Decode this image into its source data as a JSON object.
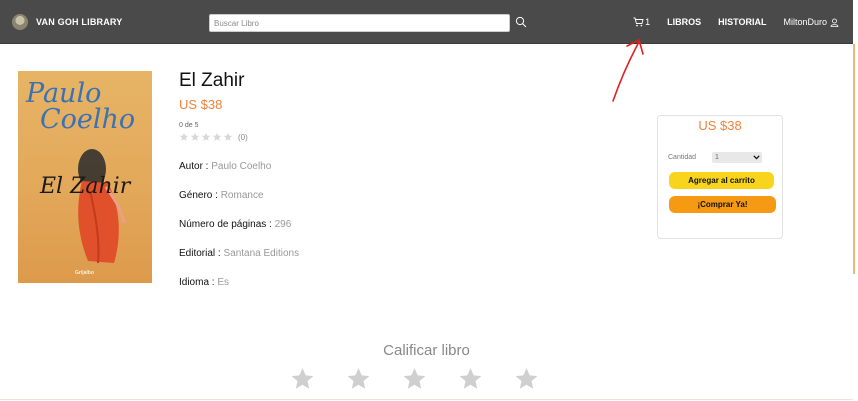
{
  "navbar": {
    "brand": "VAN GOH LIBRARY",
    "search_placeholder": "Buscar Libro",
    "cart_count": "1",
    "links": [
      "LIBROS",
      "HISTORIAL"
    ],
    "user": "MiltonDuro"
  },
  "book": {
    "title": "El Zahir",
    "price": "US $38",
    "rating_text": "0 de 5",
    "rating_count": "(0)",
    "rating_value": 0,
    "rating_max": 5,
    "fields": [
      {
        "label": "Autor : ",
        "value": "Paulo Coelho"
      },
      {
        "label": "Género : ",
        "value": "Romance"
      },
      {
        "label": "Número de páginas : ",
        "value": "296"
      },
      {
        "label": "Editorial : ",
        "value": "Santana Editions"
      },
      {
        "label": "Idioma : ",
        "value": "Es"
      }
    ],
    "cover": {
      "author_line1": "Paulo",
      "author_line2": "Coelho",
      "title": "El Zahir",
      "publisher": "Grijalbo"
    }
  },
  "purchase": {
    "price": "US $38",
    "quantity_label": "Cantidad",
    "quantity_value": "1",
    "add_to_cart": "Agregar al carrito",
    "buy_now": "¡Comprar Ya!"
  },
  "rate": {
    "title": "Calificar libro",
    "star_count": 5
  },
  "colors": {
    "navbar": "#4a4a4a",
    "price": "#f0823a",
    "cart_button": "#f8d51c",
    "buy_button": "#f59a12",
    "annotation": "#e02020"
  }
}
